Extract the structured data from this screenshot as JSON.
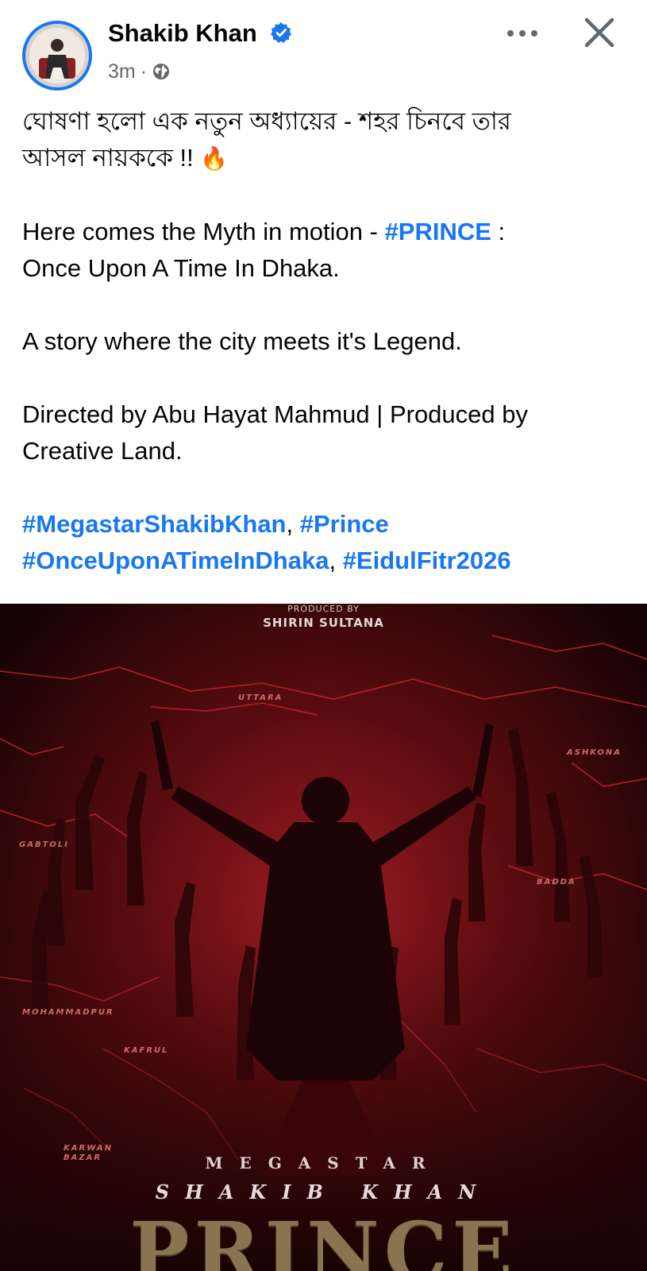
{
  "header": {
    "author_name": "Shakib Khan",
    "timestamp": "3m",
    "separator": "·",
    "privacy_icon": "globe-icon",
    "verified_icon": "verified-badge-icon",
    "more_icon": "more-options-icon",
    "close_icon": "close-icon"
  },
  "post": {
    "bengali_line1": "ঘোষণা হলো এক নতুন অধ্যায়ের - শহর চিনবে তার",
    "bengali_line2": "আসল নায়ককে !!",
    "fire_emoji": "🔥",
    "line3_prefix": "Here comes the Myth in motion - ",
    "line3_tag": "#PRINCE",
    "line3_suffix": " :",
    "line4": "Once Upon A Time In Dhaka.",
    "line5": "A story where the city meets it's Legend.",
    "line6": "Directed by Abu Hayat Mahmud | Produced by",
    "line7": "Creative Land.",
    "hashtag1": "#MegastarShakibKhan",
    "comma1": ", ",
    "hashtag2": "#Prince",
    "hashtag3": "#OnceUponATimeInDhaka",
    "comma2": ", ",
    "hashtag4": "#EidulFitr2026"
  },
  "poster": {
    "produced_by_label": "PRODUCED BY",
    "producer_name": "SHIRIN SULTANA",
    "place_uttara": "UTTARA",
    "place_ashkona": "ASHKONA",
    "place_gabtoli": "GABTOLI",
    "place_badda": "BADDA",
    "place_mohammadpur": "MOHAMMADPUR",
    "place_kafrul": "KAFRUL",
    "place_karwan_bazar": "KARWAN BAZAR",
    "megastar": "MEGASTAR",
    "hero_name": "SHAKIB KHAN",
    "title": "PRINCE"
  },
  "colors": {
    "link_blue": "#1877f2",
    "meta_gray": "#65676b",
    "poster_red": "#8e1418"
  }
}
